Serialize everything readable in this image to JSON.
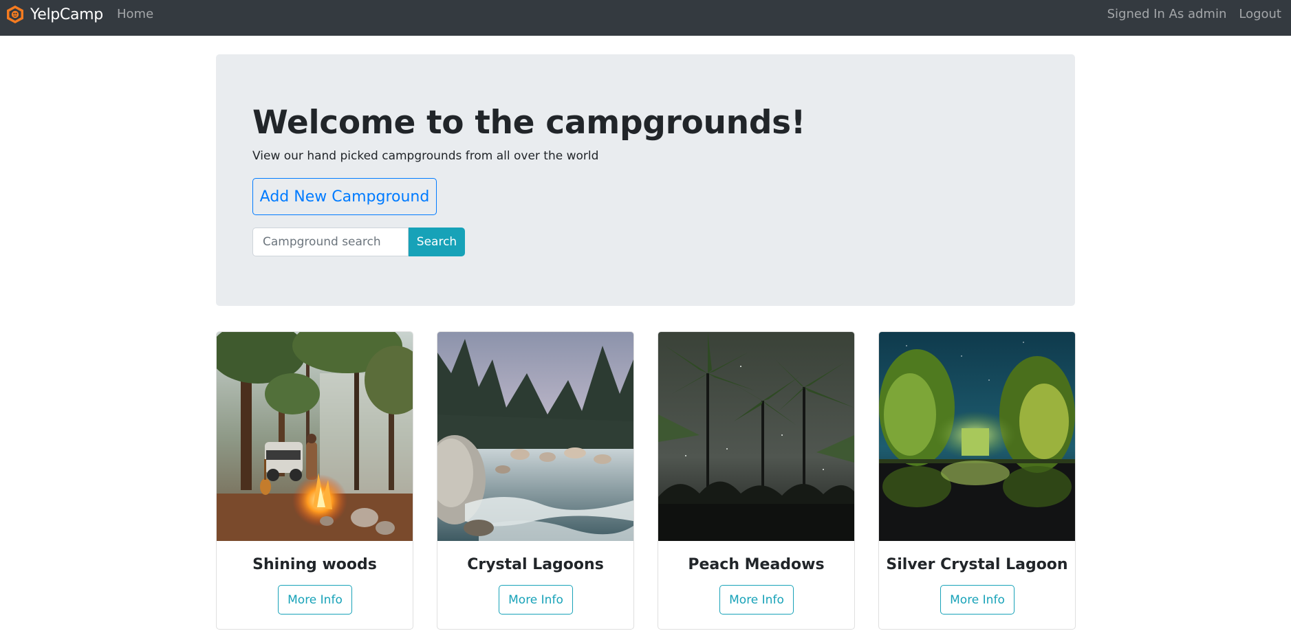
{
  "navbar": {
    "brand": "YelpCamp",
    "home": "Home",
    "signed_in": "Signed In As admin",
    "logout": "Logout"
  },
  "jumbotron": {
    "title": "Welcome to the campgrounds!",
    "subtitle": "View our hand picked campgrounds from all over the world",
    "add_button": "Add New Campground",
    "search_placeholder": "Campground search",
    "search_button": "Search"
  },
  "campgrounds": [
    {
      "name": "Shining woods",
      "button": "More Info"
    },
    {
      "name": "Crystal Lagoons",
      "button": "More Info"
    },
    {
      "name": "Peach Meadows",
      "button": "More Info"
    },
    {
      "name": "Silver Crystal Lagoon",
      "button": "More Info"
    }
  ],
  "colors": {
    "navbar_bg": "#343a40",
    "jumbotron_bg": "#e9ecef",
    "primary": "#007bff",
    "info": "#17a2b8",
    "logo_orange": "#f47b20"
  }
}
